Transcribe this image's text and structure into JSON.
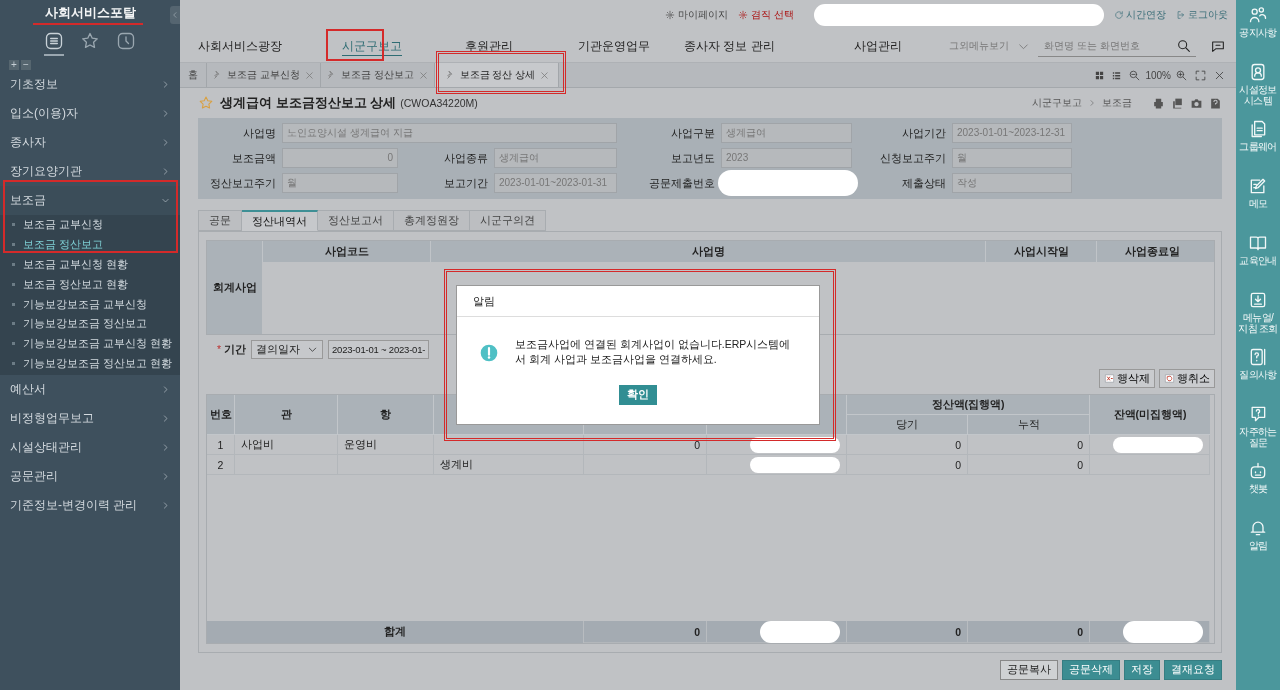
{
  "sidebar": {
    "title": "사회서비스포탈",
    "views": [
      {
        "selected": true
      },
      {
        "selected": false
      },
      {
        "selected": false
      }
    ],
    "tree_controls": [
      "+",
      "−"
    ],
    "menu": [
      {
        "label": "기초정보",
        "expanded": false
      },
      {
        "label": "입소(이용)자",
        "expanded": false
      },
      {
        "label": "종사자",
        "expanded": false
      },
      {
        "label": "장기요양기관",
        "expanded": false
      },
      {
        "label": "보조금",
        "expanded": true,
        "children": [
          {
            "label": "보조금 교부신청",
            "selected": false
          },
          {
            "label": "보조금 정산보고",
            "selected": true
          },
          {
            "label": "보조금 교부신청 현황",
            "selected": false
          },
          {
            "label": "보조금 정산보고 현황",
            "selected": false
          },
          {
            "label": "기능보강보조금 교부신청",
            "selected": false
          },
          {
            "label": "기능보강보조금 정산보고",
            "selected": false
          },
          {
            "label": "기능보강보조금 교부신청 현황",
            "selected": false
          },
          {
            "label": "기능보강보조금 정산보고 현황",
            "selected": false
          }
        ]
      },
      {
        "label": "예산서",
        "expanded": false
      },
      {
        "label": "비정형업무보고",
        "expanded": false
      },
      {
        "label": "시설상태관리",
        "expanded": false
      },
      {
        "label": "공문관리",
        "expanded": false
      },
      {
        "label": "기준정보-변경이력 관리",
        "expanded": false
      }
    ]
  },
  "top_bar": {
    "links": [
      {
        "label": "마이페이지",
        "kind": "normal"
      },
      {
        "label": "겸직 선택",
        "kind": "alert"
      }
    ],
    "actions": [
      {
        "label": "시간연장"
      },
      {
        "label": "로그아웃"
      }
    ]
  },
  "nav": {
    "items": [
      {
        "label": "사회서비스광장",
        "selected": false
      },
      {
        "label": "시군구보고",
        "selected": true
      },
      {
        "label": "후원관리",
        "selected": false
      },
      {
        "label": "기관운영업무",
        "selected": false
      },
      {
        "label": "종사자 정보 관리",
        "selected": false
      },
      {
        "label": "사업관리",
        "selected": false
      }
    ],
    "more": "그외메뉴보기",
    "search": {
      "placeholder": "화면명 또는 화면번호"
    }
  },
  "tabs": [
    {
      "label": "홈",
      "selected": false,
      "kind": "home"
    },
    {
      "label": "보조금 교부신청",
      "selected": false,
      "kind": "pinned"
    },
    {
      "label": "보조금 정산보고",
      "selected": false,
      "kind": "pinned"
    },
    {
      "label": "보조금 정산 상세",
      "selected": true,
      "kind": "pinned"
    }
  ],
  "zoom": "100%",
  "page": {
    "title": "생계급여 보조금정산보고 상세",
    "code": "(CWOA34220M)",
    "breadcrumb": [
      "시군구보고",
      "보조금"
    ]
  },
  "form": [
    {
      "label": "사업명",
      "value": "노인요양시설 생계급여 지급",
      "kind": "wide"
    },
    {
      "label": "사업구분",
      "value": "생계급여",
      "kind": "text"
    },
    {
      "label": "사업기간",
      "value": "2023-01-01~2023-12-31",
      "kind": "text"
    },
    {
      "label": "보조금액",
      "value": "0",
      "kind": "number"
    },
    {
      "label": "사업종류",
      "value": "생계급여",
      "kind": "text"
    },
    {
      "label": "보고년도",
      "value": "2023",
      "kind": "text"
    },
    {
      "label": "신청보고주기",
      "value": "월",
      "kind": "text"
    },
    {
      "label": "정산보고주기",
      "value": "월",
      "kind": "text"
    },
    {
      "label": "보고기간",
      "value": "2023-01-01~2023-01-31",
      "kind": "text"
    },
    {
      "label": "공문제출번호",
      "kind": "redacted"
    },
    {
      "label": "제출상태",
      "value": "작성",
      "kind": "text"
    }
  ],
  "subtabs": [
    {
      "label": "공문",
      "selected": false
    },
    {
      "label": "정산내역서",
      "selected": true
    },
    {
      "label": "정산보고서",
      "selected": false
    },
    {
      "label": "총계정원장",
      "selected": false
    },
    {
      "label": "시군구의견",
      "selected": false
    }
  ],
  "account_table": {
    "title": "회계사업",
    "columns": [
      "사업코드",
      "사업명",
      "사업시작일",
      "사업종료일"
    ]
  },
  "filter": {
    "label": "기간",
    "required_mark": "*",
    "select": "결의일자",
    "range": "2023-01-01 ~ 2023-01-"
  },
  "row_buttons": [
    {
      "label": "행삭제"
    },
    {
      "label": "행취소"
    }
  ],
  "table": {
    "columns": [
      "번호",
      "관",
      "항",
      null,
      null,
      null
    ],
    "group": {
      "label": "정산액(집행액)",
      "columns": [
        "당기",
        "누적"
      ]
    },
    "last": "잔액(미집행액)",
    "rows": [
      {
        "cells": [
          "1",
          "사업비",
          "운영비",
          null,
          "0",
          {
            "kind": "redacted"
          },
          "0",
          "0",
          {
            "kind": "redacted"
          }
        ]
      },
      {
        "cells": [
          "2",
          null,
          null,
          "생계비",
          null,
          {
            "kind": "redacted"
          },
          "0",
          "0",
          null
        ]
      }
    ],
    "totals": {
      "label": "합계",
      "cells": [
        "0",
        {
          "kind": "redacted"
        },
        "0",
        "0",
        {
          "kind": "redacted"
        }
      ]
    }
  },
  "footer_buttons": [
    {
      "label": "공문복사",
      "kind": "plain"
    },
    {
      "label": "공문삭제",
      "kind": "primary"
    },
    {
      "label": "저장",
      "kind": "primary"
    },
    {
      "label": "결재요청",
      "kind": "primary"
    }
  ],
  "modal": {
    "title": "알림",
    "message": "보조금사업에 연결된 회계사업이 없습니다.ERP시스템에서 회계 사업과 보조금사업을 연결하세요.",
    "button": "확인"
  },
  "right_bar": [
    {
      "label": "공지사항"
    },
    {
      "label": "시설정보\n시스템"
    },
    {
      "label": "그룹웨어"
    },
    {
      "label": "메모"
    },
    {
      "label": "교육안내"
    },
    {
      "label": "메뉴얼/\n지침 조회"
    },
    {
      "label": "질의사항"
    },
    {
      "label": "자주하는\n질문"
    },
    {
      "label": "챗봇"
    },
    {
      "label": "알림"
    }
  ]
}
